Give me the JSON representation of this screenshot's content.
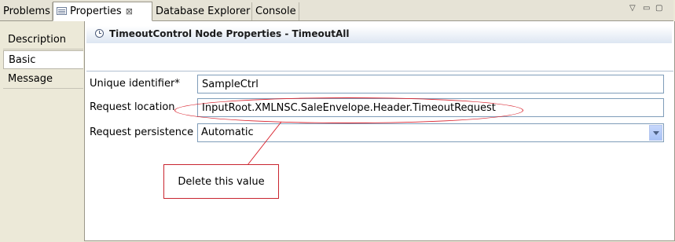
{
  "tabs": [
    {
      "label": "Problems",
      "active": false
    },
    {
      "label": "Properties",
      "active": true,
      "icon": "properties-icon",
      "close": "⊠"
    },
    {
      "label": "Database Explorer",
      "active": false
    },
    {
      "label": "Console",
      "active": false
    }
  ],
  "view_controls": {
    "menu": "▽",
    "minimize": "▭",
    "maximize": "▢"
  },
  "categories": [
    {
      "label": "Description",
      "selected": false
    },
    {
      "label": "Basic",
      "selected": true
    },
    {
      "label": "Message",
      "selected": false
    }
  ],
  "header": {
    "icon": "clock-icon",
    "title": "TimeoutControl Node Properties - TimeoutAll"
  },
  "form": {
    "unique_identifier": {
      "label": "Unique identifier*",
      "value": "SampleCtrl"
    },
    "request_location": {
      "label": "Request location",
      "value": "InputRoot.XMLNSC.SaleEnvelope.Header.TimeoutRequest"
    },
    "request_persistence": {
      "label": "Request persistence",
      "value": "Automatic",
      "options": [
        "Automatic"
      ]
    }
  },
  "annotation": {
    "callout_text": "Delete this value",
    "color": "#d9232e"
  },
  "colors": {
    "chrome": "#ece9d8",
    "field_border": "#7f9db9",
    "header_gradient": "#dde6f2"
  }
}
